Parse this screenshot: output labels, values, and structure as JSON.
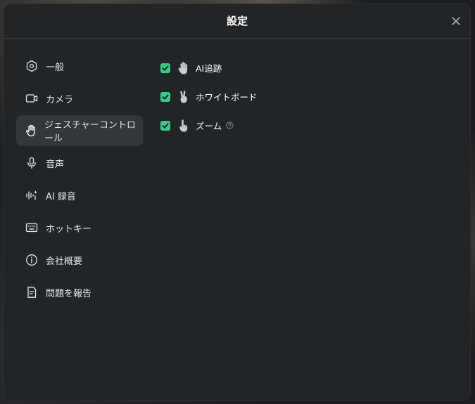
{
  "dialog": {
    "title": "設定",
    "close_icon": "close-icon"
  },
  "sidebar": {
    "items": [
      {
        "label": "一般",
        "icon": "hexagon-settings-icon",
        "active": false
      },
      {
        "label": "カメラ",
        "icon": "camera-icon",
        "active": false
      },
      {
        "label": "ジェスチャーコントロール",
        "icon": "hand-icon",
        "active": true
      },
      {
        "label": "音声",
        "icon": "microphone-icon",
        "active": false
      },
      {
        "label": "AI 録音",
        "icon": "ai-audio-icon",
        "active": false
      },
      {
        "label": "ホットキー",
        "icon": "keyboard-icon",
        "active": false
      },
      {
        "label": "会社概要",
        "icon": "info-icon",
        "active": false
      },
      {
        "label": "問題を報告",
        "icon": "document-icon",
        "active": false
      }
    ]
  },
  "gestures": {
    "options": [
      {
        "label": "AI追跡",
        "checked": true,
        "icon": "open-hand-gesture-icon"
      },
      {
        "label": "ホワイトボード",
        "checked": true,
        "icon": "two-finger-gesture-icon"
      },
      {
        "label": "ズーム",
        "checked": true,
        "icon": "pointing-finger-gesture-icon",
        "help_icon": "question-icon"
      }
    ]
  },
  "colors": {
    "accent": "#2fcf88",
    "panel": "#222528",
    "active_item": "#33373b"
  }
}
